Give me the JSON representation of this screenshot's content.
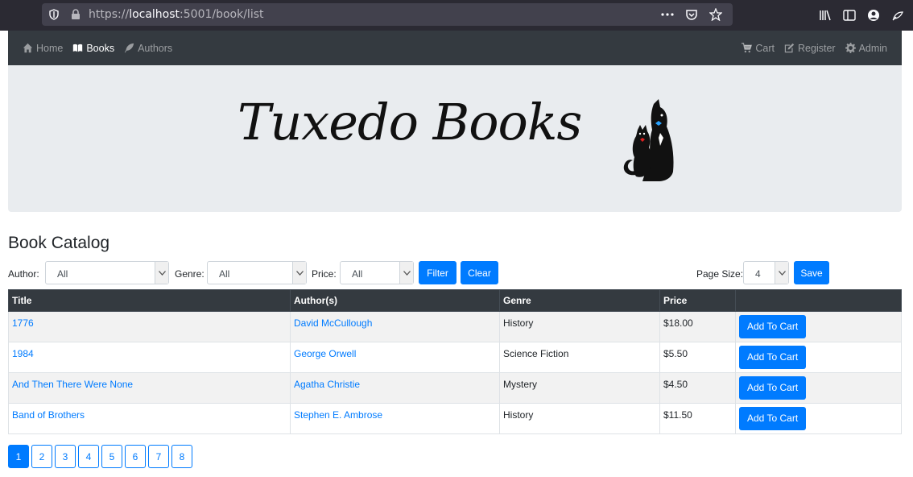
{
  "browser": {
    "url_prefix": "https://",
    "url_host": "localhost",
    "url_rest": ":5001/book/list"
  },
  "nav": {
    "left": [
      {
        "label": "Home",
        "icon": "home-icon",
        "active": false
      },
      {
        "label": "Books",
        "icon": "book-icon",
        "active": true
      },
      {
        "label": "Authors",
        "icon": "feather-icon",
        "active": false
      }
    ],
    "right": [
      {
        "label": "Cart",
        "icon": "cart-icon"
      },
      {
        "label": "Register",
        "icon": "edit-icon"
      },
      {
        "label": "Admin",
        "icon": "gear-icon"
      }
    ]
  },
  "banner": {
    "logo_text": "Tuxedo Books"
  },
  "catalog": {
    "title": "Book Catalog",
    "filters": {
      "author_label": "Author:",
      "author_value": "All",
      "genre_label": "Genre:",
      "genre_value": "All",
      "price_label": "Price:",
      "price_value": "All",
      "filter_button": "Filter",
      "clear_button": "Clear",
      "page_size_label": "Page Size:",
      "page_size_value": "4",
      "save_button": "Save"
    },
    "columns": [
      "Title",
      "Author(s)",
      "Genre",
      "Price",
      ""
    ],
    "rows": [
      {
        "title": "1776",
        "author": "David McCullough",
        "genre": "History",
        "price": "$18.00",
        "action": "Add To Cart"
      },
      {
        "title": "1984",
        "author": "George Orwell",
        "genre": "Science Fiction",
        "price": "$5.50",
        "action": "Add To Cart"
      },
      {
        "title": "And Then There Were None",
        "author": "Agatha Christie",
        "genre": "Mystery",
        "price": "$4.50",
        "action": "Add To Cart"
      },
      {
        "title": "Band of Brothers",
        "author": "Stephen E. Ambrose",
        "genre": "History",
        "price": "$11.50",
        "action": "Add To Cart"
      }
    ],
    "pages": [
      "1",
      "2",
      "3",
      "4",
      "5",
      "6",
      "7",
      "8"
    ],
    "current_page": "1"
  },
  "colors": {
    "primary": "#007bff",
    "navbar": "#343a40",
    "jumbotron": "#e9ecef"
  }
}
